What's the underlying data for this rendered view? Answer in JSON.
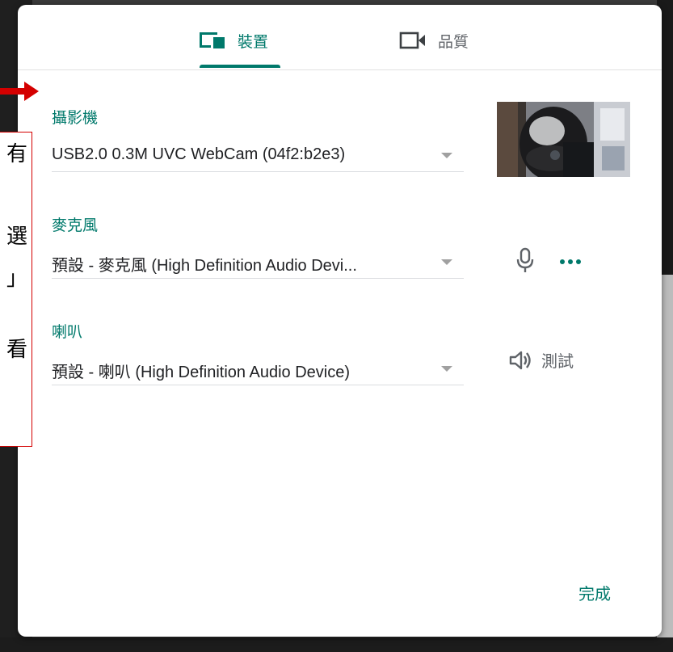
{
  "tabs": {
    "devices_label": "裝置",
    "quality_label": "品質"
  },
  "camera": {
    "label": "攝影機",
    "value": "USB2.0 0.3M UVC WebCam (04f2:b2e3)"
  },
  "microphone": {
    "label": "麥克風",
    "value": "預設 - 麥克風 (High Definition Audio Devi..."
  },
  "speaker": {
    "label": "喇叭",
    "value": "預設 - 喇叭 (High Definition Audio Device)",
    "test_label": "測試"
  },
  "footer": {
    "done_label": "完成"
  },
  "annotation": {
    "chars": [
      "有",
      "選",
      "」",
      "看"
    ]
  },
  "colors": {
    "accent": "#00796b",
    "annotation_red": "#d40000"
  }
}
